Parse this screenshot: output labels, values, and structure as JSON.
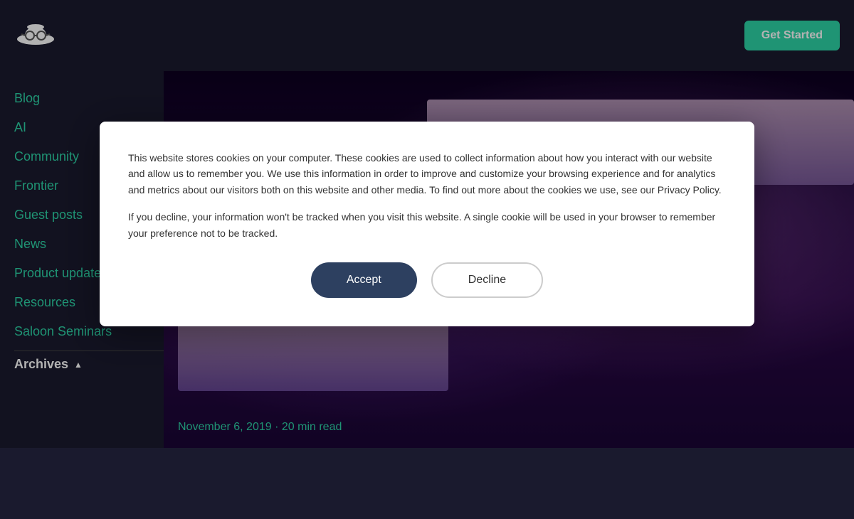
{
  "header": {
    "get_started_label": "Get Started"
  },
  "sidebar": {
    "items": [
      {
        "label": "Blog",
        "id": "blog"
      },
      {
        "label": "AI",
        "id": "ai"
      },
      {
        "label": "Community",
        "id": "community"
      },
      {
        "label": "Frontier",
        "id": "frontier"
      },
      {
        "label": "Guest posts",
        "id": "guest-posts"
      },
      {
        "label": "News",
        "id": "news"
      },
      {
        "label": "Product updates",
        "id": "product-updates"
      },
      {
        "label": "Resources",
        "id": "resources"
      },
      {
        "label": "Saloon Seminars",
        "id": "saloon-seminars"
      }
    ],
    "archives_label": "Archives",
    "archives_chevron": "^"
  },
  "hero": {
    "date": "November 6, 2019",
    "separator": "·",
    "read_time": "20 min read"
  },
  "cookie_modal": {
    "paragraph1": "This website stores cookies on your computer. These cookies are used to collect information about how you interact with our website and allow us to remember you. We use this information in order to improve and customize your browsing experience and for analytics and metrics about our visitors both on this website and other media. To find out more about the cookies we use, see our Privacy Policy.",
    "paragraph2": "If you decline, your information won't be tracked when you visit this website. A single cookie will be used in your browser to remember your preference not to be tracked.",
    "accept_label": "Accept",
    "decline_label": "Decline"
  }
}
